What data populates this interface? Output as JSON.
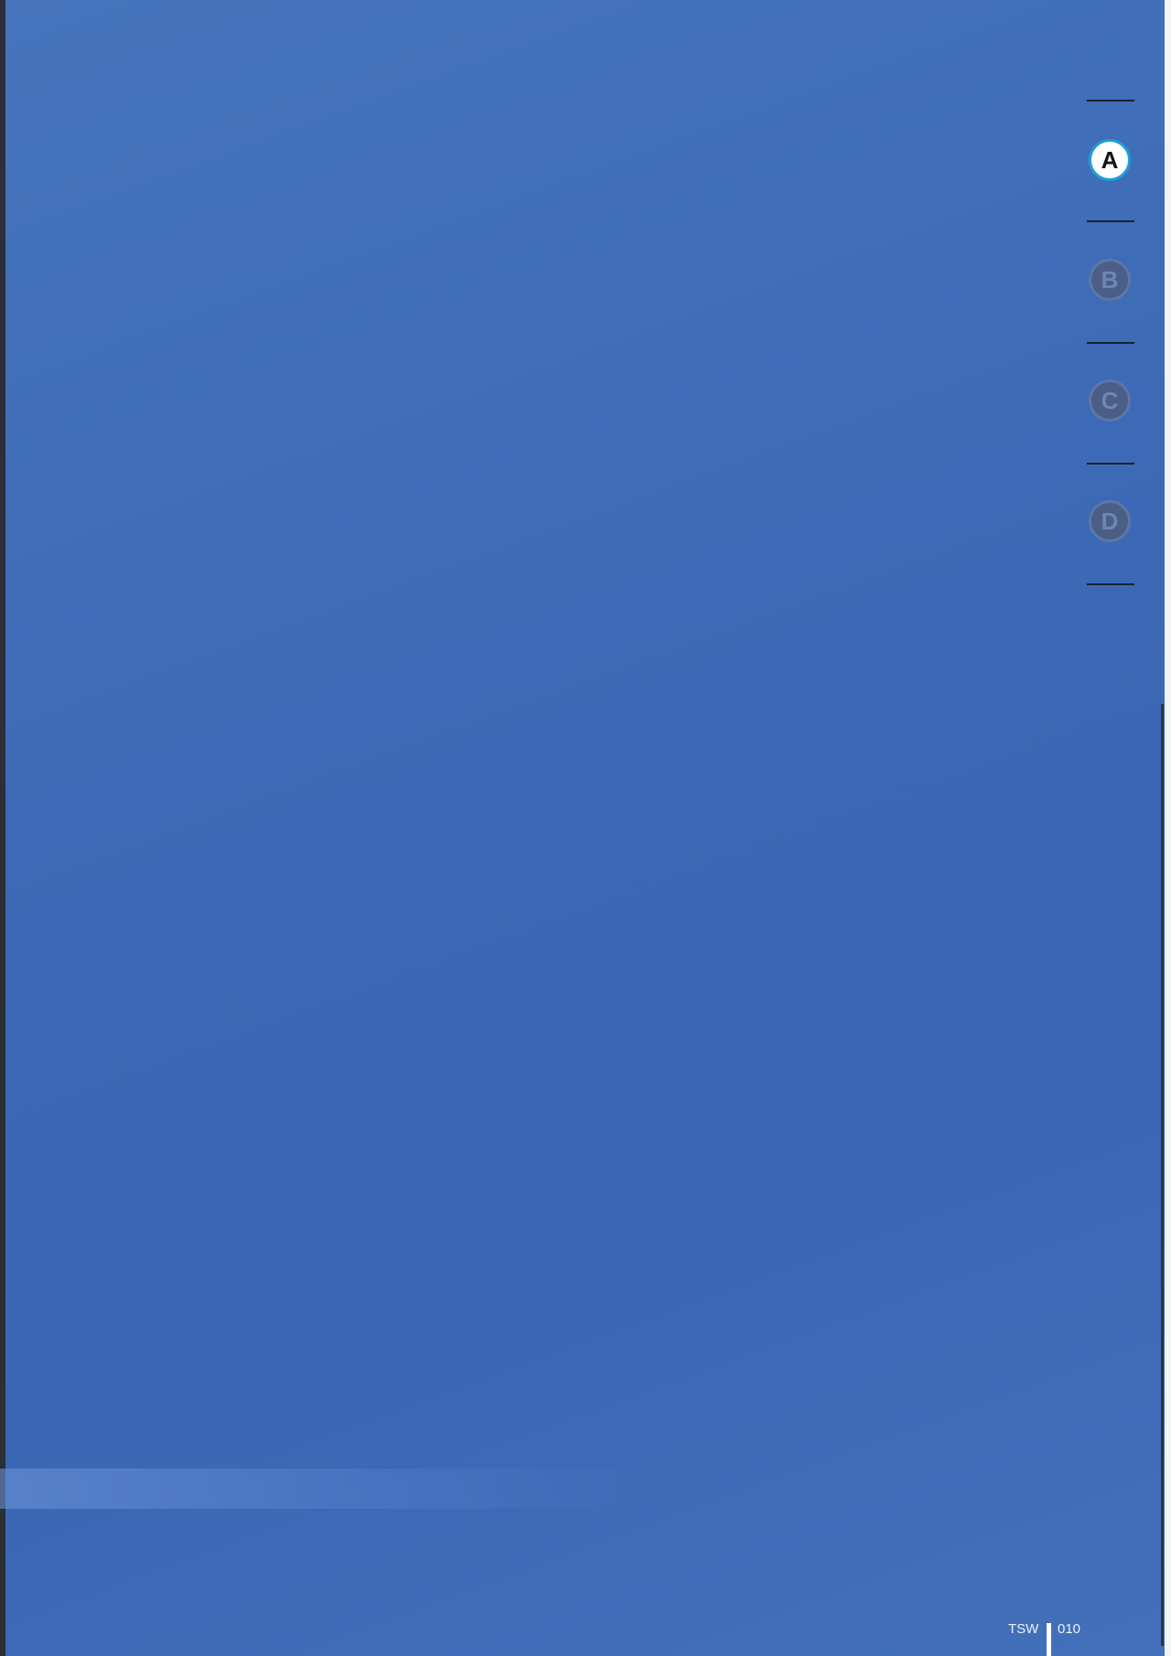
{
  "section_tabs": {
    "active": "A",
    "items": [
      {
        "label": "A",
        "state": "active"
      },
      {
        "label": "B",
        "state": "inactive"
      },
      {
        "label": "C",
        "state": "inactive"
      },
      {
        "label": "D",
        "state": "inactive"
      }
    ]
  },
  "footer": {
    "label": "TSW",
    "page_number": "010"
  },
  "colors": {
    "page_background": "#3c69b5",
    "tab_active_fill": "#ffffff",
    "tab_active_ring": "#1e9fd6",
    "tab_inactive_fill": "#4b5e85",
    "footer_text": "#eef2fb"
  }
}
